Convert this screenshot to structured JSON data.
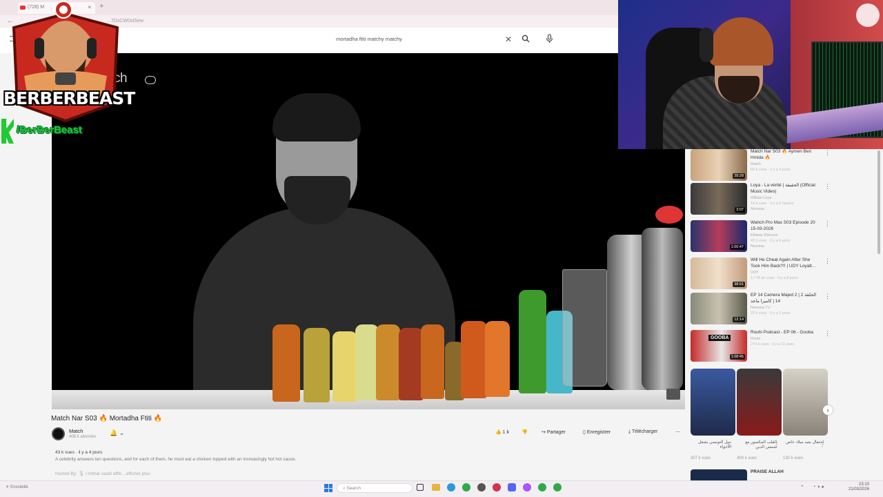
{
  "browser": {
    "tab_title": "(728) M",
    "tab_close": "×",
    "new_tab": "+",
    "url": "...7DsCW0sISew"
  },
  "youtube": {
    "search_query": "mortadha ftiti matchy matchy"
  },
  "video": {
    "watermark": "ch",
    "title": "Match Nar S03 🔥 Mortadha Ftiti 🔥",
    "channel": "Match",
    "subscribers": "408 k abonnés",
    "likes": "1 k",
    "actions": {
      "share": "Partager",
      "save": "Enregistrer",
      "download": "Télécharger"
    },
    "description_meta": "43 k vues · il y a 4 jours",
    "description_text": "A celebrity answers ten questions, and for each of them, he must eat a chicken topped with an increasingly hot hot sauce.",
    "description_host": "Hosted By:",
    "description_host_names": "🎙 / mithal saadi affiti",
    "show_more": "...afficher plus"
  },
  "streamer": {
    "name": "BERBERBEAST",
    "handle": "/BerBerBeast"
  },
  "recommendations": [
    {
      "title": "Match Nar S03 🔥 Aymen Ben Hmida 🔥",
      "channel": "Match",
      "meta": "89 k vues · il y a 4 jours",
      "duration": "28:28"
    },
    {
      "title": "Loya - La vérité | الحقيقة (Official Music Video)",
      "channel": "Officiel Loya",
      "meta": "14 k vues · il y a 5 heures",
      "duration": "3:07",
      "badge": "Nouveau"
    },
    {
      "title": "Wahch Pro Max S03 Episode 20 15-03-2026",
      "channel": "Elhiwar Ettounsi",
      "meta": "43 k vues · il y a 6 jours",
      "duration": "1:00:47",
      "badge": "Nouveau"
    },
    {
      "title": "Will He Cheat Again After She Took Him Back?!! | UDY Loyalt...",
      "channel": "UDY",
      "meta": "1,7 M de vues · il y a 8 jours",
      "duration": "38:01"
    },
    {
      "title": "EP 14 Camera Majed 2 | 2 الحلقة 14 | كاميرا ماجد",
      "channel": "Nessma TV",
      "meta": "22 k vues · il y a 2 jours",
      "duration": "12:14"
    },
    {
      "title": "Rouhi Podcast - EP 06 - Gooba",
      "channel": "Rouhi",
      "meta": "274 k vues · il y a 11 jours",
      "duration": "1:08:45",
      "thumb_text": "GOOBA"
    }
  ],
  "shorts": [
    {
      "title": "نبيل التونسي يشعل الأجواء",
      "views": "307 k vues"
    },
    {
      "title": "القلب المكسور مع شمس الدين",
      "views": "400 k vues"
    },
    {
      "title": "إحتفال بعيد ميلاد خاص",
      "views": "130 k vues"
    }
  ],
  "next_title": "PRAISE ALLAH",
  "taskbar": {
    "search": "Search",
    "weather": "Ensoleillé",
    "time": "23:10",
    "date": "21/03/2026"
  },
  "colors": {
    "accent_red": "#e03535",
    "brand_green": "#21c932",
    "logo_red": "#c8291f"
  }
}
